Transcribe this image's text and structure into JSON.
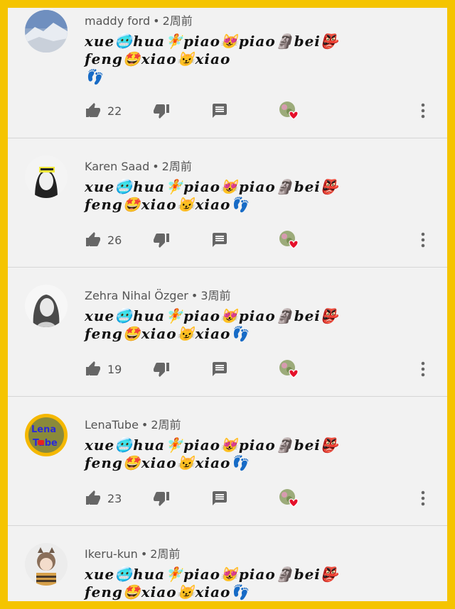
{
  "colors": {
    "frame": "#f5c400",
    "background": "#f2f2f2",
    "meta_text": "#555555",
    "icon": "#666666",
    "heart": "#e5102a"
  },
  "comments": [
    {
      "author": "maddy ford",
      "time": "2周前",
      "line1": "xue🥶hua🧚piao😻piao🗿bei👺",
      "line2": "feng🤩xiao😼xiao",
      "line3": "👣",
      "likes": "22",
      "avatar": "snowy-mountain"
    },
    {
      "author": "Karen Saad",
      "time": "2周前",
      "line1": "xue🥶hua🧚piao😻piao🗿bei👺",
      "line2": "feng🤩xiao😼xiao👣",
      "likes": "26",
      "avatar": "portrait-bw"
    },
    {
      "author": "Zehra Nihal Özger",
      "time": "3周前",
      "line1": "xue🥶hua🧚piao😻piao🗿bei👺",
      "line2": "feng🤩xiao😼xiao👣",
      "likes": "19",
      "avatar": "sketch-woman"
    },
    {
      "author": "LenaTube",
      "time": "2周前",
      "line1": "xue🥶hua🧚piao😻piao🗿bei👺",
      "line2": "feng🤩xiao😼xiao👣",
      "likes": "23",
      "avatar": "lena-tube-logo"
    },
    {
      "author": "Ikeru-kun",
      "time": "2周前",
      "line1": "xue🥶hua🧚piao😻piao🗿bei👺",
      "line2": "feng🤩xiao😼xiao👣",
      "avatar": "anime-character"
    }
  ]
}
